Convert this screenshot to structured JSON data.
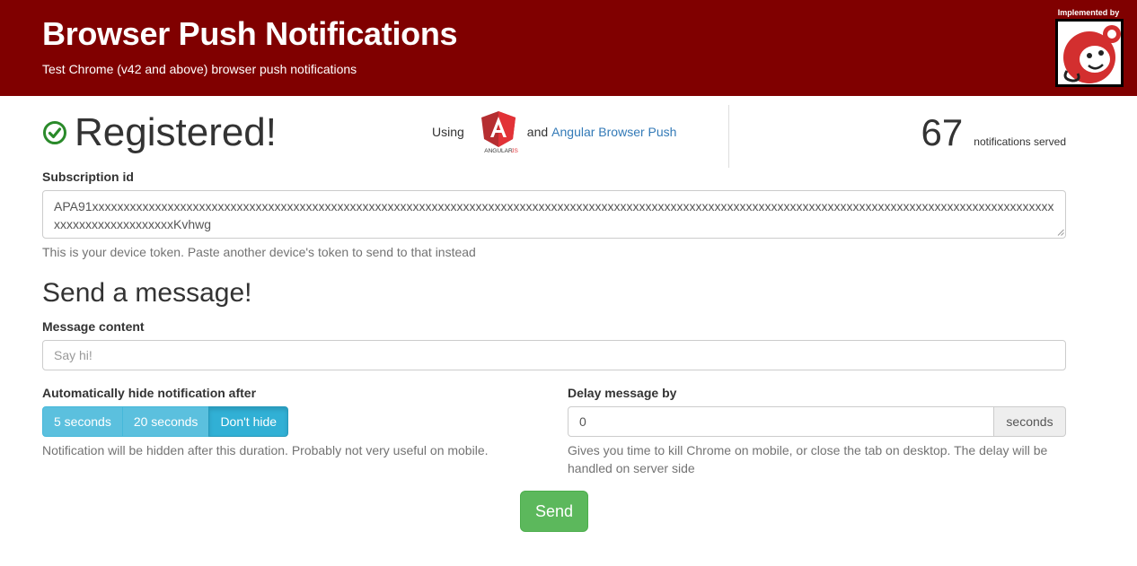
{
  "header": {
    "title": "Browser Push Notifications",
    "subtitle": "Test Chrome (v42 and above) browser push notifications",
    "implemented_by": "Implemented by",
    "logo_icon": "monkey-logo-icon",
    "background": "#800000"
  },
  "status": {
    "icon": "check-circle-icon",
    "text": "Registered!",
    "icon_color": "#2a8a2a"
  },
  "using": {
    "prefix": "Using",
    "logo_icon": "angularjs-logo-icon",
    "and": "and",
    "link_text": "Angular Browser Push"
  },
  "stats": {
    "count": "67",
    "label": "notifications served"
  },
  "subscription": {
    "label": "Subscription id",
    "token": "APA91xxxxxxxxxxxxxxxxxxxxxxxxxxxxxxxxxxxxxxxxxxxxxxxxxxxxxxxxxxxxxxxxxxxxxxxxxxxxxxxxxxxxxxxxxxxxxxxxxxxxxxxxxxxxxxxxxxxxxxxxxxxxxxxxxxxxxxxxxxxxxxxxxxxxxxxxxxxxxxxxxxxxxxxxxxxxKvhwg",
    "help": "This is your device token. Paste another device's token to send to that instead"
  },
  "send_section": {
    "heading": "Send a message!",
    "message_label": "Message content",
    "message_placeholder": "Say hi!",
    "hide_label": "Automatically hide notification after",
    "hide_options": [
      "5 seconds",
      "20 seconds",
      "Don't hide"
    ],
    "hide_selected": "Don't hide",
    "hide_help": "Notification will be hidden after this duration. Probably not very useful on mobile.",
    "delay_label": "Delay message by",
    "delay_value": "0",
    "delay_unit": "seconds",
    "delay_help": "Gives you time to kill Chrome on mobile, or close the tab on desktop. The delay will be handled on server side",
    "send_label": "Send"
  },
  "colors": {
    "accent_blue": "#337ab7",
    "info": "#5bc0de",
    "success": "#5cb85c"
  }
}
